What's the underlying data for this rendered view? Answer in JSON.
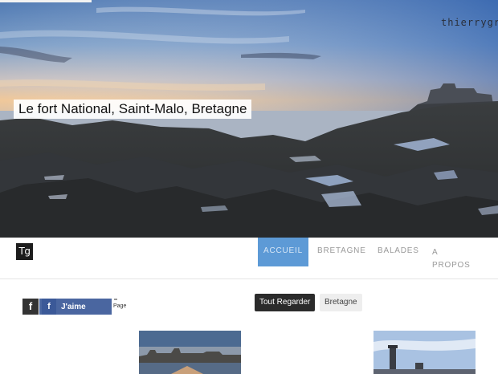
{
  "hero": {
    "title": "Le fort National, Saint-Malo, Bretagne",
    "watermark": "thierrygr"
  },
  "logo": {
    "text": "Tg"
  },
  "nav": {
    "items": [
      {
        "label": "ACCUEIL",
        "active": true
      },
      {
        "label": "BRETAGNE",
        "active": false
      },
      {
        "label": "BALADES",
        "active": false
      },
      {
        "label": "A PROPOS",
        "active": false
      }
    ]
  },
  "facebook": {
    "icon": "f",
    "like_label": "J'aime",
    "page_label": "Page"
  },
  "filters": [
    {
      "label": "Tout Regarder",
      "active": true
    },
    {
      "label": "Bretagne",
      "active": false
    }
  ],
  "thumbnails": [
    {
      "icon": "saint-malo-ramparts-photo"
    },
    {
      "icon": "lighthouse-photo"
    }
  ],
  "colors": {
    "nav_active": "#5d9ad6",
    "facebook": "#4a66a0",
    "filter_active": "#2b2b2b"
  }
}
